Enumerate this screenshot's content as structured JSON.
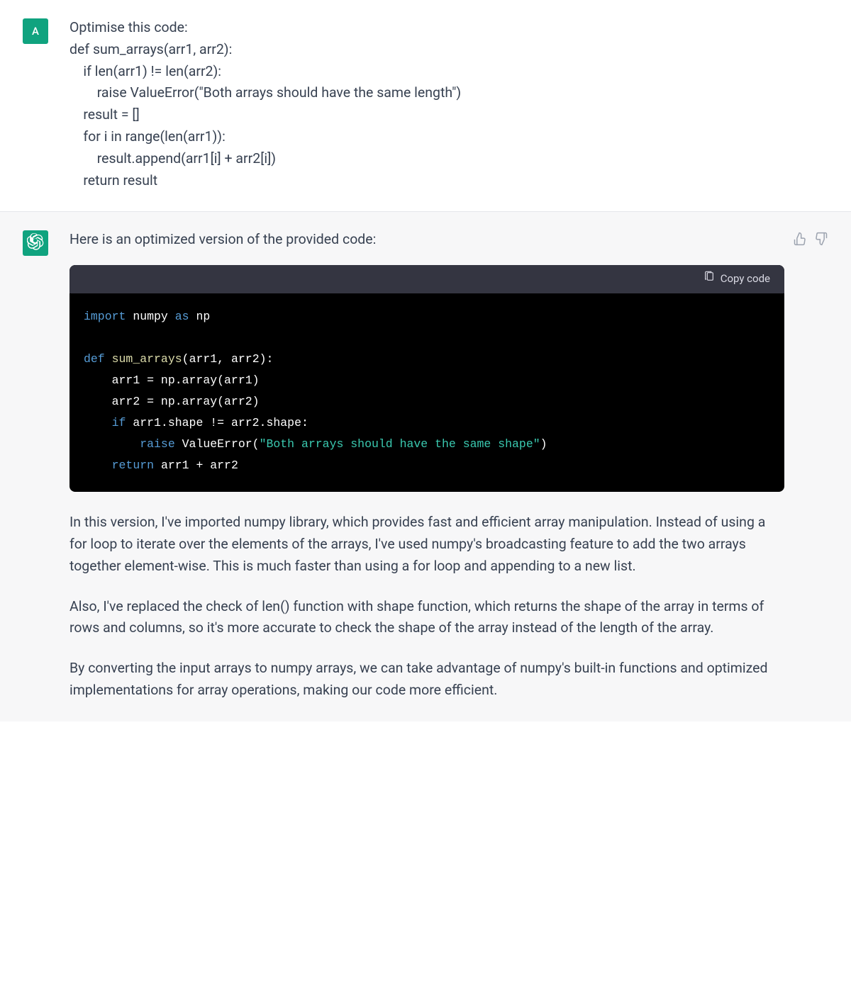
{
  "user_avatar_letter": "A",
  "user_message": {
    "intro": "Optimise this code:",
    "lines": [
      "def sum_arrays(arr1, arr2):",
      "    if len(arr1) != len(arr2):",
      "        raise ValueError(\"Both arrays should have the same length\")",
      "    result = []",
      "    for i in range(len(arr1)):",
      "        result.append(arr1[i] + arr2[i])",
      "    return result"
    ]
  },
  "assistant_message": {
    "intro": "Here is an optimized version of the provided code:",
    "copy_label": "Copy code",
    "code_tokens": [
      [
        [
          "kw",
          "import"
        ],
        [
          "sp",
          " "
        ],
        [
          "id",
          "numpy"
        ],
        [
          "sp",
          " "
        ],
        [
          "kw",
          "as"
        ],
        [
          "sp",
          " "
        ],
        [
          "id",
          "np"
        ]
      ],
      [],
      [
        [
          "kw",
          "def"
        ],
        [
          "sp",
          " "
        ],
        [
          "fn",
          "sum_arrays"
        ],
        [
          "op",
          "("
        ],
        [
          "id",
          "arr1"
        ],
        [
          "op",
          ", "
        ],
        [
          "id",
          "arr2"
        ],
        [
          "op",
          "):"
        ]
      ],
      [
        [
          "sp",
          "    "
        ],
        [
          "id",
          "arr1 = np.array(arr1)"
        ]
      ],
      [
        [
          "sp",
          "    "
        ],
        [
          "id",
          "arr2 = np.array(arr2)"
        ]
      ],
      [
        [
          "sp",
          "    "
        ],
        [
          "kw",
          "if"
        ],
        [
          "sp",
          " "
        ],
        [
          "id",
          "arr1.shape != arr2.shape:"
        ]
      ],
      [
        [
          "sp",
          "        "
        ],
        [
          "kw",
          "raise"
        ],
        [
          "sp",
          " "
        ],
        [
          "id",
          "ValueError("
        ],
        [
          "str",
          "\"Both arrays should have the same shape\""
        ],
        [
          "id",
          ")"
        ]
      ],
      [
        [
          "sp",
          "    "
        ],
        [
          "kw",
          "return"
        ],
        [
          "sp",
          " "
        ],
        [
          "id",
          "arr1 + arr2"
        ]
      ]
    ],
    "paragraphs": [
      "In this version, I've imported numpy library, which provides fast and efficient array manipulation. Instead of using a for loop to iterate over the elements of the arrays, I've used numpy's broadcasting feature to add the two arrays together element-wise. This is much faster than using a for loop and appending to a new list.",
      "Also, I've replaced the check of len() function with shape function, which returns the shape of the array in terms of rows and columns, so it's more accurate to check the shape of the array instead of the length of the array.",
      "By converting the input arrays to numpy arrays, we can take advantage of numpy's built-in functions and optimized implementations for array operations, making our code more efficient."
    ]
  }
}
